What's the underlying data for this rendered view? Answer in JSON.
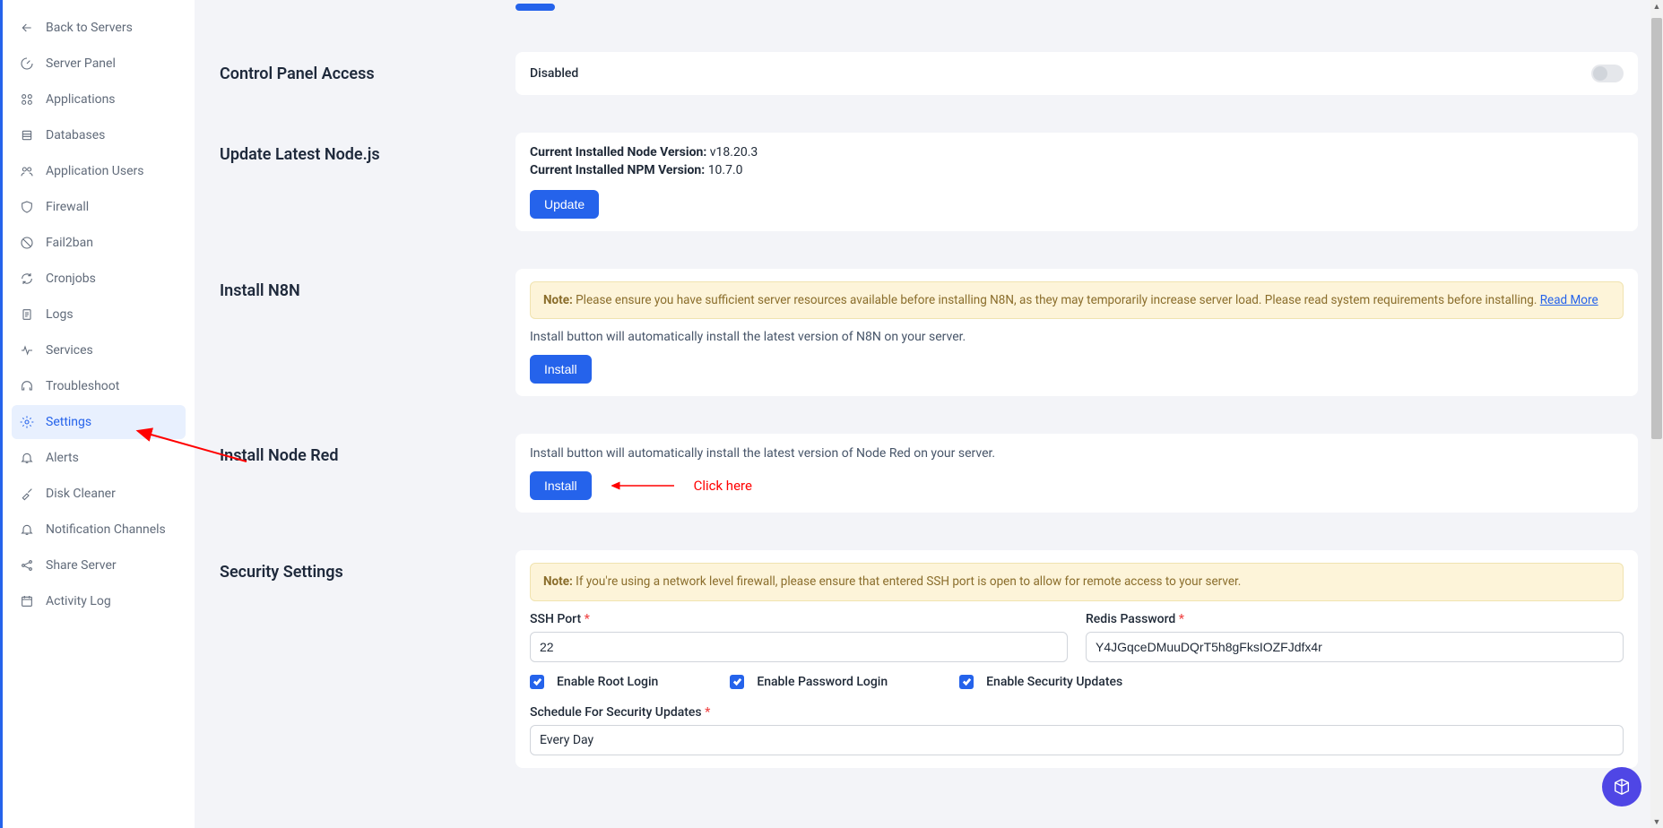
{
  "sidebar": {
    "items": [
      {
        "label": "Back to Servers"
      },
      {
        "label": "Server Panel"
      },
      {
        "label": "Applications"
      },
      {
        "label": "Databases"
      },
      {
        "label": "Application Users"
      },
      {
        "label": "Firewall"
      },
      {
        "label": "Fail2ban"
      },
      {
        "label": "Cronjobs"
      },
      {
        "label": "Logs"
      },
      {
        "label": "Services"
      },
      {
        "label": "Troubleshoot"
      },
      {
        "label": "Settings"
      },
      {
        "label": "Alerts"
      },
      {
        "label": "Disk Cleaner"
      },
      {
        "label": "Notification Channels"
      },
      {
        "label": "Share Server"
      },
      {
        "label": "Activity Log"
      }
    ]
  },
  "sections": {
    "control_panel": {
      "title": "Control Panel Access",
      "status": "Disabled"
    },
    "node": {
      "title": "Update Latest Node.js",
      "node_label": "Current Installed Node Version:",
      "node_value": " v18.20.3",
      "npm_label": "Current Installed NPM Version:",
      "npm_value": " 10.7.0",
      "button": "Update"
    },
    "n8n": {
      "title": "Install N8N",
      "note_prefix": "Note:",
      "note_text": " Please ensure you have sufficient server resources available before installing N8N, as they may temporarily increase server load. Please read system requirements before installing. ",
      "read_more": "Read More",
      "desc": "Install button will automatically install the latest version of N8N on your server.",
      "button": "Install"
    },
    "nodered": {
      "title": "Install Node Red",
      "desc": "Install button will automatically install the latest version of Node Red on your server.",
      "button": "Install"
    },
    "security": {
      "title": "Security Settings",
      "note_prefix": "Note:",
      "note_text": " If you're using a network level firewall, please ensure that entered SSH port is open to allow for remote access to your server.",
      "ssh_label": "SSH Port",
      "ssh_value": "22",
      "redis_label": "Redis Password",
      "redis_value": "Y4JGqceDMuuDQrT5h8gFksIOZFJdfx4r",
      "check1": "Enable Root Login",
      "check2": "Enable Password Login",
      "check3": "Enable Security Updates",
      "schedule_label": "Schedule For Security Updates",
      "schedule_value": "Every Day"
    }
  },
  "annotation": {
    "click_here": "Click here"
  }
}
